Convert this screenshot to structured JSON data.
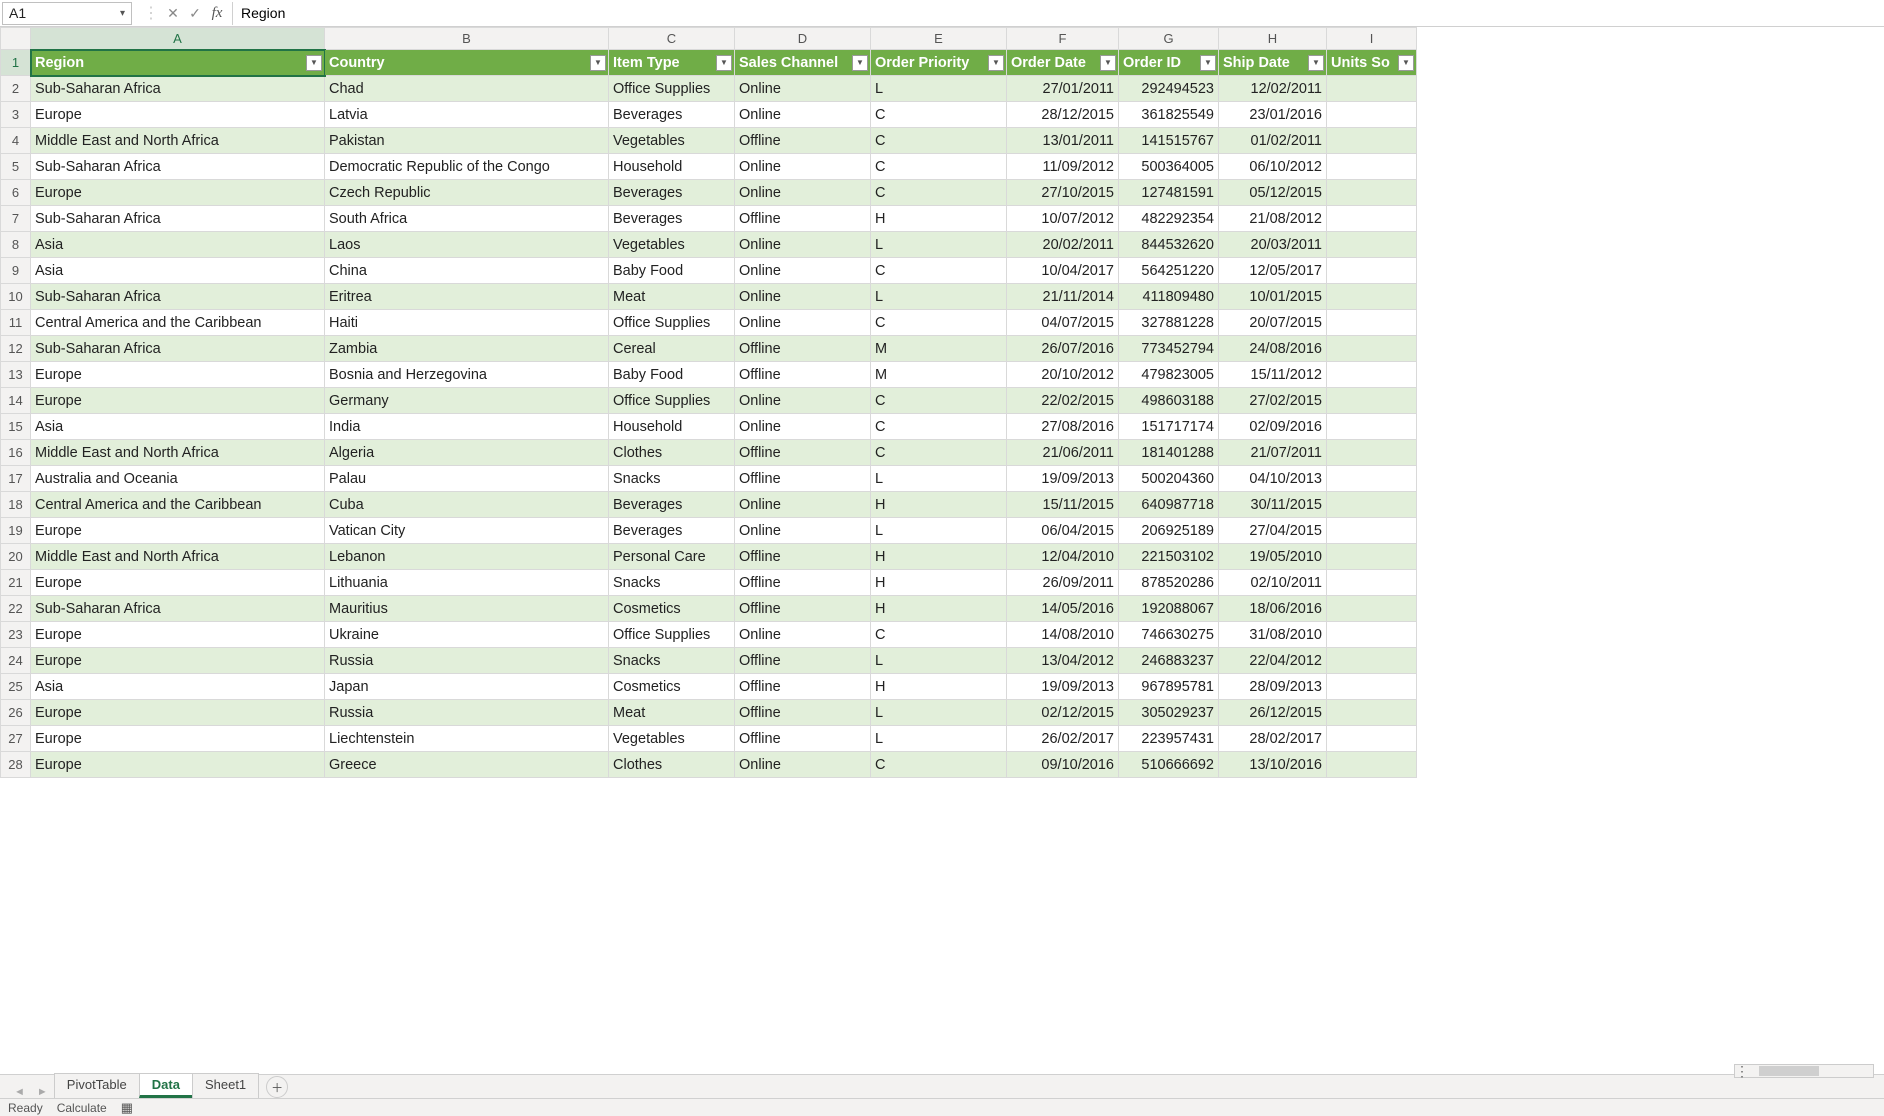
{
  "name_box": "A1",
  "formula_value": "Region",
  "col_letters": [
    "A",
    "B",
    "C",
    "D",
    "E",
    "F",
    "G",
    "H",
    "I"
  ],
  "headers": [
    "Region",
    "Country",
    "Item Type",
    "Sales Channel",
    "Order Priority",
    "Order Date",
    "Order ID",
    "Ship Date",
    "Units So"
  ],
  "rows": [
    {
      "n": 2,
      "c": [
        "Sub-Saharan Africa",
        "Chad",
        "Office Supplies",
        "Online",
        "L",
        "27/01/2011",
        "292494523",
        "12/02/2011",
        ""
      ]
    },
    {
      "n": 3,
      "c": [
        "Europe",
        "Latvia",
        "Beverages",
        "Online",
        "C",
        "28/12/2015",
        "361825549",
        "23/01/2016",
        ""
      ]
    },
    {
      "n": 4,
      "c": [
        "Middle East and North Africa",
        "Pakistan",
        "Vegetables",
        "Offline",
        "C",
        "13/01/2011",
        "141515767",
        "01/02/2011",
        ""
      ]
    },
    {
      "n": 5,
      "c": [
        "Sub-Saharan Africa",
        "Democratic Republic of the Congo",
        "Household",
        "Online",
        "C",
        "11/09/2012",
        "500364005",
        "06/10/2012",
        ""
      ]
    },
    {
      "n": 6,
      "c": [
        "Europe",
        "Czech Republic",
        "Beverages",
        "Online",
        "C",
        "27/10/2015",
        "127481591",
        "05/12/2015",
        ""
      ]
    },
    {
      "n": 7,
      "c": [
        "Sub-Saharan Africa",
        "South Africa",
        "Beverages",
        "Offline",
        "H",
        "10/07/2012",
        "482292354",
        "21/08/2012",
        ""
      ]
    },
    {
      "n": 8,
      "c": [
        "Asia",
        "Laos",
        "Vegetables",
        "Online",
        "L",
        "20/02/2011",
        "844532620",
        "20/03/2011",
        ""
      ]
    },
    {
      "n": 9,
      "c": [
        "Asia",
        "China",
        "Baby Food",
        "Online",
        "C",
        "10/04/2017",
        "564251220",
        "12/05/2017",
        ""
      ]
    },
    {
      "n": 10,
      "c": [
        "Sub-Saharan Africa",
        "Eritrea",
        "Meat",
        "Online",
        "L",
        "21/11/2014",
        "411809480",
        "10/01/2015",
        ""
      ]
    },
    {
      "n": 11,
      "c": [
        "Central America and the Caribbean",
        "Haiti",
        "Office Supplies",
        "Online",
        "C",
        "04/07/2015",
        "327881228",
        "20/07/2015",
        ""
      ]
    },
    {
      "n": 12,
      "c": [
        "Sub-Saharan Africa",
        "Zambia",
        "Cereal",
        "Offline",
        "M",
        "26/07/2016",
        "773452794",
        "24/08/2016",
        ""
      ]
    },
    {
      "n": 13,
      "c": [
        "Europe",
        "Bosnia and Herzegovina",
        "Baby Food",
        "Offline",
        "M",
        "20/10/2012",
        "479823005",
        "15/11/2012",
        ""
      ]
    },
    {
      "n": 14,
      "c": [
        "Europe",
        "Germany",
        "Office Supplies",
        "Online",
        "C",
        "22/02/2015",
        "498603188",
        "27/02/2015",
        ""
      ]
    },
    {
      "n": 15,
      "c": [
        "Asia",
        "India",
        "Household",
        "Online",
        "C",
        "27/08/2016",
        "151717174",
        "02/09/2016",
        ""
      ]
    },
    {
      "n": 16,
      "c": [
        "Middle East and North Africa",
        "Algeria",
        "Clothes",
        "Offline",
        "C",
        "21/06/2011",
        "181401288",
        "21/07/2011",
        ""
      ]
    },
    {
      "n": 17,
      "c": [
        "Australia and Oceania",
        "Palau",
        "Snacks",
        "Offline",
        "L",
        "19/09/2013",
        "500204360",
        "04/10/2013",
        ""
      ]
    },
    {
      "n": 18,
      "c": [
        "Central America and the Caribbean",
        "Cuba",
        "Beverages",
        "Online",
        "H",
        "15/11/2015",
        "640987718",
        "30/11/2015",
        ""
      ]
    },
    {
      "n": 19,
      "c": [
        "Europe",
        "Vatican City",
        "Beverages",
        "Online",
        "L",
        "06/04/2015",
        "206925189",
        "27/04/2015",
        ""
      ]
    },
    {
      "n": 20,
      "c": [
        "Middle East and North Africa",
        "Lebanon",
        "Personal Care",
        "Offline",
        "H",
        "12/04/2010",
        "221503102",
        "19/05/2010",
        ""
      ]
    },
    {
      "n": 21,
      "c": [
        "Europe",
        "Lithuania",
        "Snacks",
        "Offline",
        "H",
        "26/09/2011",
        "878520286",
        "02/10/2011",
        ""
      ]
    },
    {
      "n": 22,
      "c": [
        "Sub-Saharan Africa",
        "Mauritius",
        "Cosmetics",
        "Offline",
        "H",
        "14/05/2016",
        "192088067",
        "18/06/2016",
        ""
      ]
    },
    {
      "n": 23,
      "c": [
        "Europe",
        "Ukraine",
        "Office Supplies",
        "Online",
        "C",
        "14/08/2010",
        "746630275",
        "31/08/2010",
        ""
      ]
    },
    {
      "n": 24,
      "c": [
        "Europe",
        "Russia",
        "Snacks",
        "Offline",
        "L",
        "13/04/2012",
        "246883237",
        "22/04/2012",
        ""
      ]
    },
    {
      "n": 25,
      "c": [
        "Asia",
        "Japan",
        "Cosmetics",
        "Offline",
        "H",
        "19/09/2013",
        "967895781",
        "28/09/2013",
        ""
      ]
    },
    {
      "n": 26,
      "c": [
        "Europe",
        "Russia",
        "Meat",
        "Offline",
        "L",
        "02/12/2015",
        "305029237",
        "26/12/2015",
        ""
      ]
    },
    {
      "n": 27,
      "c": [
        "Europe",
        "Liechtenstein",
        "Vegetables",
        "Offline",
        "L",
        "26/02/2017",
        "223957431",
        "28/02/2017",
        ""
      ]
    },
    {
      "n": 28,
      "c": [
        "Europe",
        "Greece",
        "Clothes",
        "Online",
        "C",
        "09/10/2016",
        "510666692",
        "13/10/2016",
        ""
      ]
    }
  ],
  "right_align_cols": [
    5,
    6,
    7
  ],
  "sheet_tabs": [
    "PivotTable",
    "Data",
    "Sheet1"
  ],
  "active_sheet": 1,
  "status": {
    "ready": "Ready",
    "calc": "Calculate"
  }
}
